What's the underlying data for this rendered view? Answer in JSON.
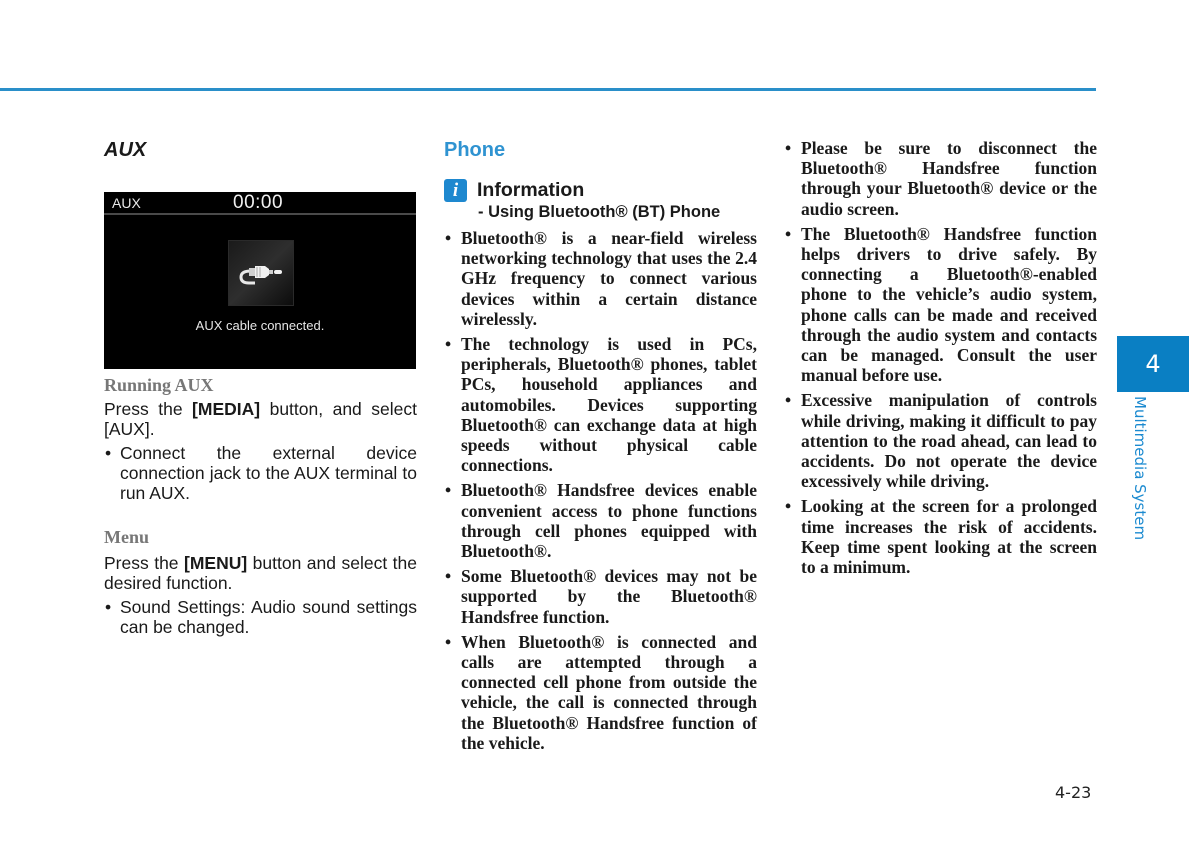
{
  "header": {
    "rule_color": "#2a8fc9"
  },
  "aux_section": {
    "heading": "AUX",
    "screen": {
      "source_label": "AUX",
      "time": "00:00",
      "icon": "aux-cable-icon",
      "message": "AUX cable connected."
    },
    "running": {
      "title": "Running AUX",
      "text_before": "Press the ",
      "button": "[MEDIA]",
      "text_after": " button, and select [AUX].",
      "bullets": [
        "Connect the external device connection jack to the AUX terminal to run AUX."
      ]
    },
    "menu": {
      "title": "Menu",
      "text_before": "Press the ",
      "button": "[MENU]",
      "text_after": " button and select the desired function.",
      "bullets": [
        "Sound Settings: Audio sound settings can be changed."
      ]
    }
  },
  "phone_section": {
    "heading": "Phone",
    "info": {
      "icon": "info-icon",
      "icon_glyph": "i",
      "title": "Information",
      "subtitle": "- Using Bluetooth® (BT) Phone"
    },
    "bullets": [
      "Bluetooth® is a near-field wireless networking technology that uses the 2.4 GHz frequency to connect various devices within a certain distance wirelessly.",
      "The technology is used in PCs, peripherals, Bluetooth® phones, tablet PCs, household appliances and automobiles. Devices supporting Bluetooth® can exchange data at high speeds without physical cable connections.",
      "Bluetooth® Handsfree devices enable convenient access to phone functions through cell phones equipped with Bluetooth®.",
      "Some Bluetooth® devices may not be supported by the Bluetooth® Handsfree function.",
      "When Bluetooth® is connected and calls are attempted through a connected cell phone from outside the vehicle, the call is connected through the Bluetooth® Handsfree function of the vehicle."
    ]
  },
  "right_column": {
    "bullets": [
      "Please be sure to disconnect the Bluetooth® Handsfree function through your Bluetooth® device or the audio screen.",
      "The Bluetooth® Handsfree function helps drivers to drive safely. By connecting a Bluetooth®-enabled phone to the vehicle’s audio system, phone calls can be made and received through the audio system and contacts can be managed. Consult the user manual before use.",
      "Excessive manipulation of controls while driving, making it difficult to pay attention to the road ahead, can lead to accidents. Do not operate the device excessively while driving.",
      "Looking at the screen for a prolonged time increases the risk of accidents. Keep time spent looking at the screen to a minimum."
    ]
  },
  "chapter": {
    "number": "4",
    "title": "Multimedia System",
    "color": "#0a7fc3"
  },
  "footer": {
    "page_number": "4-23"
  }
}
